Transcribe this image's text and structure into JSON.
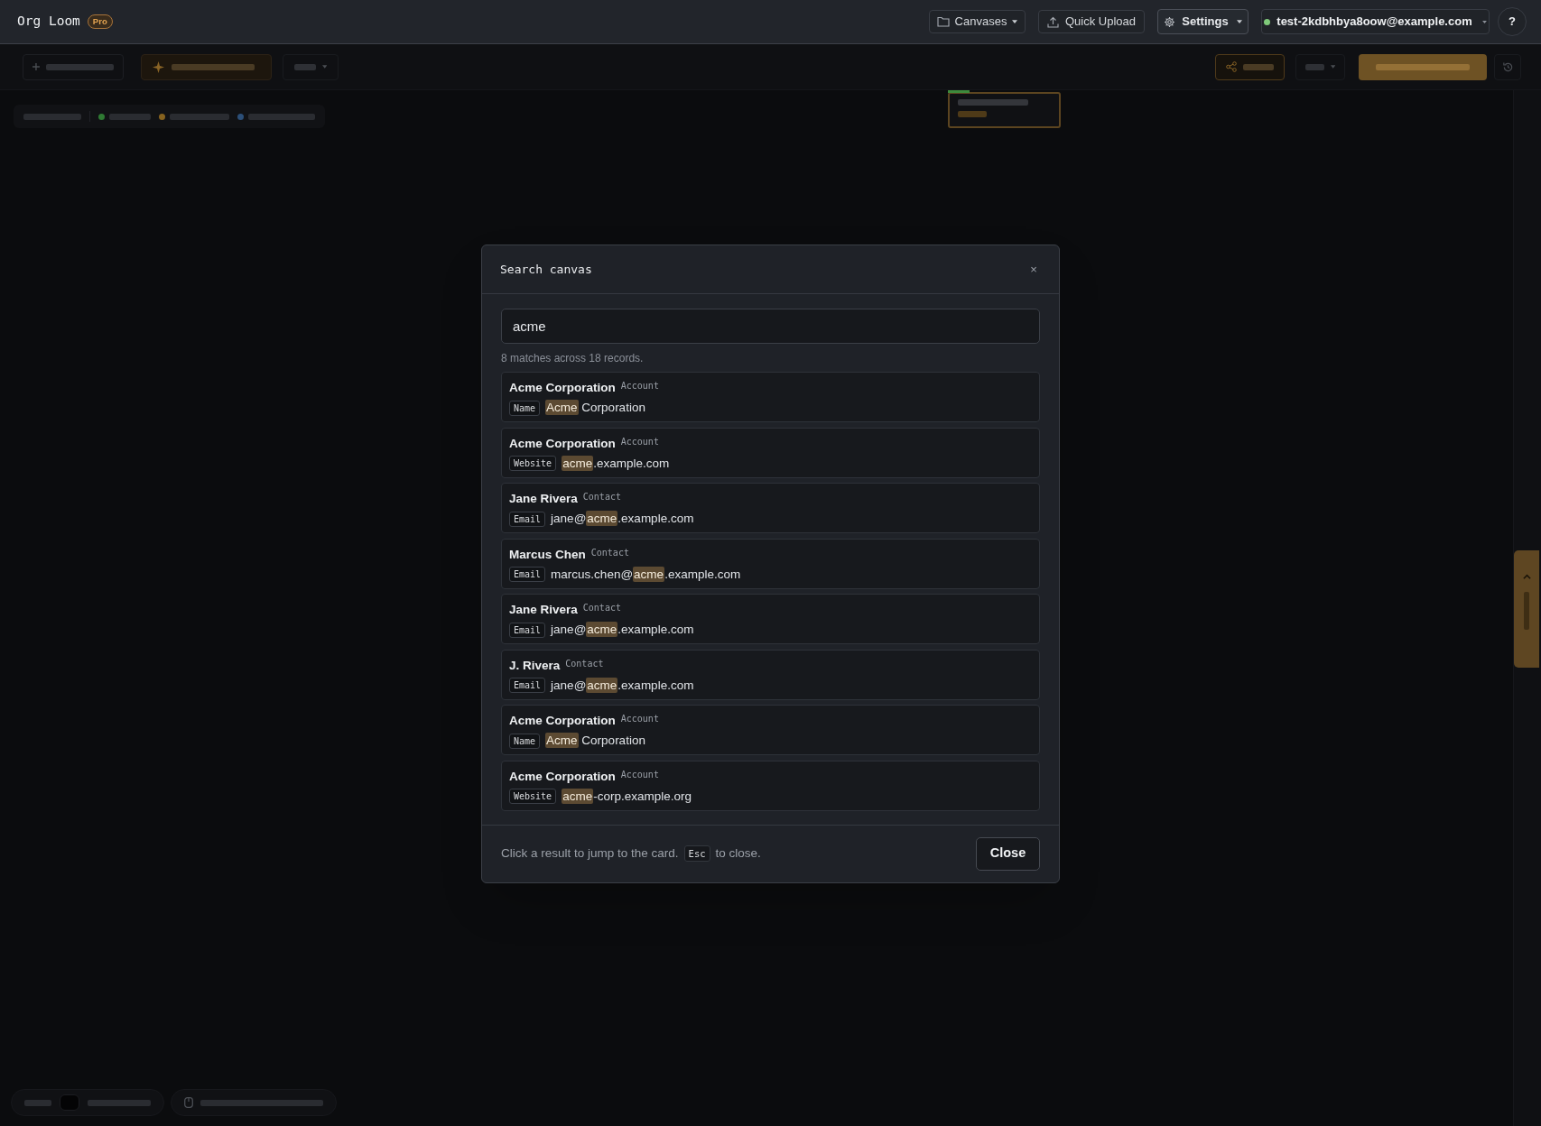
{
  "app": {
    "name": "Org Loom",
    "badge": "Pro"
  },
  "nav": {
    "canvases": "Canvases",
    "upload": "Quick Upload",
    "settings": "Settings",
    "account": "test-2kdbhbya8oow@example.com",
    "help": "?"
  },
  "stats": {
    "items": [
      {
        "color": "#2f7a33"
      },
      {
        "color": "#86621f"
      },
      {
        "color": "#2c4f78"
      }
    ]
  },
  "search_dialog": {
    "title": "Search canvas",
    "close": "×",
    "query": "acme",
    "summary": "8 matches across 18 records.",
    "results": [
      {
        "title": "Acme Corporation",
        "type": "Account",
        "field": "Name",
        "value": [
          {
            "text": "Acme",
            "highlight": true
          },
          {
            "text": " Corporation",
            "highlight": false
          }
        ]
      },
      {
        "title": "Acme Corporation",
        "type": "Account",
        "field": "Website",
        "value": [
          {
            "text": "acme",
            "highlight": true
          },
          {
            "text": ".example.com",
            "highlight": false
          }
        ]
      },
      {
        "title": "Jane Rivera",
        "type": "Contact",
        "field": "Email",
        "value": [
          {
            "text": "jane@",
            "highlight": false
          },
          {
            "text": "acme",
            "highlight": true
          },
          {
            "text": ".example.com",
            "highlight": false
          }
        ]
      },
      {
        "title": "Marcus Chen",
        "type": "Contact",
        "field": "Email",
        "value": [
          {
            "text": "marcus.chen@",
            "highlight": false
          },
          {
            "text": "acme",
            "highlight": true
          },
          {
            "text": ".example.com",
            "highlight": false
          }
        ]
      },
      {
        "title": "Jane Rivera",
        "type": "Contact",
        "field": "Email",
        "value": [
          {
            "text": "jane@",
            "highlight": false
          },
          {
            "text": "acme",
            "highlight": true
          },
          {
            "text": ".example.com",
            "highlight": false
          }
        ]
      },
      {
        "title": "J. Rivera",
        "type": "Contact",
        "field": "Email",
        "value": [
          {
            "text": "jane@",
            "highlight": false
          },
          {
            "text": "acme",
            "highlight": true
          },
          {
            "text": ".example.com",
            "highlight": false
          }
        ]
      },
      {
        "title": "Acme Corporation",
        "type": "Account",
        "field": "Name",
        "value": [
          {
            "text": "Acme",
            "highlight": true
          },
          {
            "text": " Corporation",
            "highlight": false
          }
        ]
      },
      {
        "title": "Acme Corporation",
        "type": "Account",
        "field": "Website",
        "value": [
          {
            "text": "acme",
            "highlight": true
          },
          {
            "text": "-corp.example.org",
            "highlight": false
          }
        ]
      }
    ],
    "footer": {
      "hint": "Click a result to jump to the card.",
      "key": "Esc",
      "hint_end": "to close.",
      "close_button": "Close"
    }
  }
}
